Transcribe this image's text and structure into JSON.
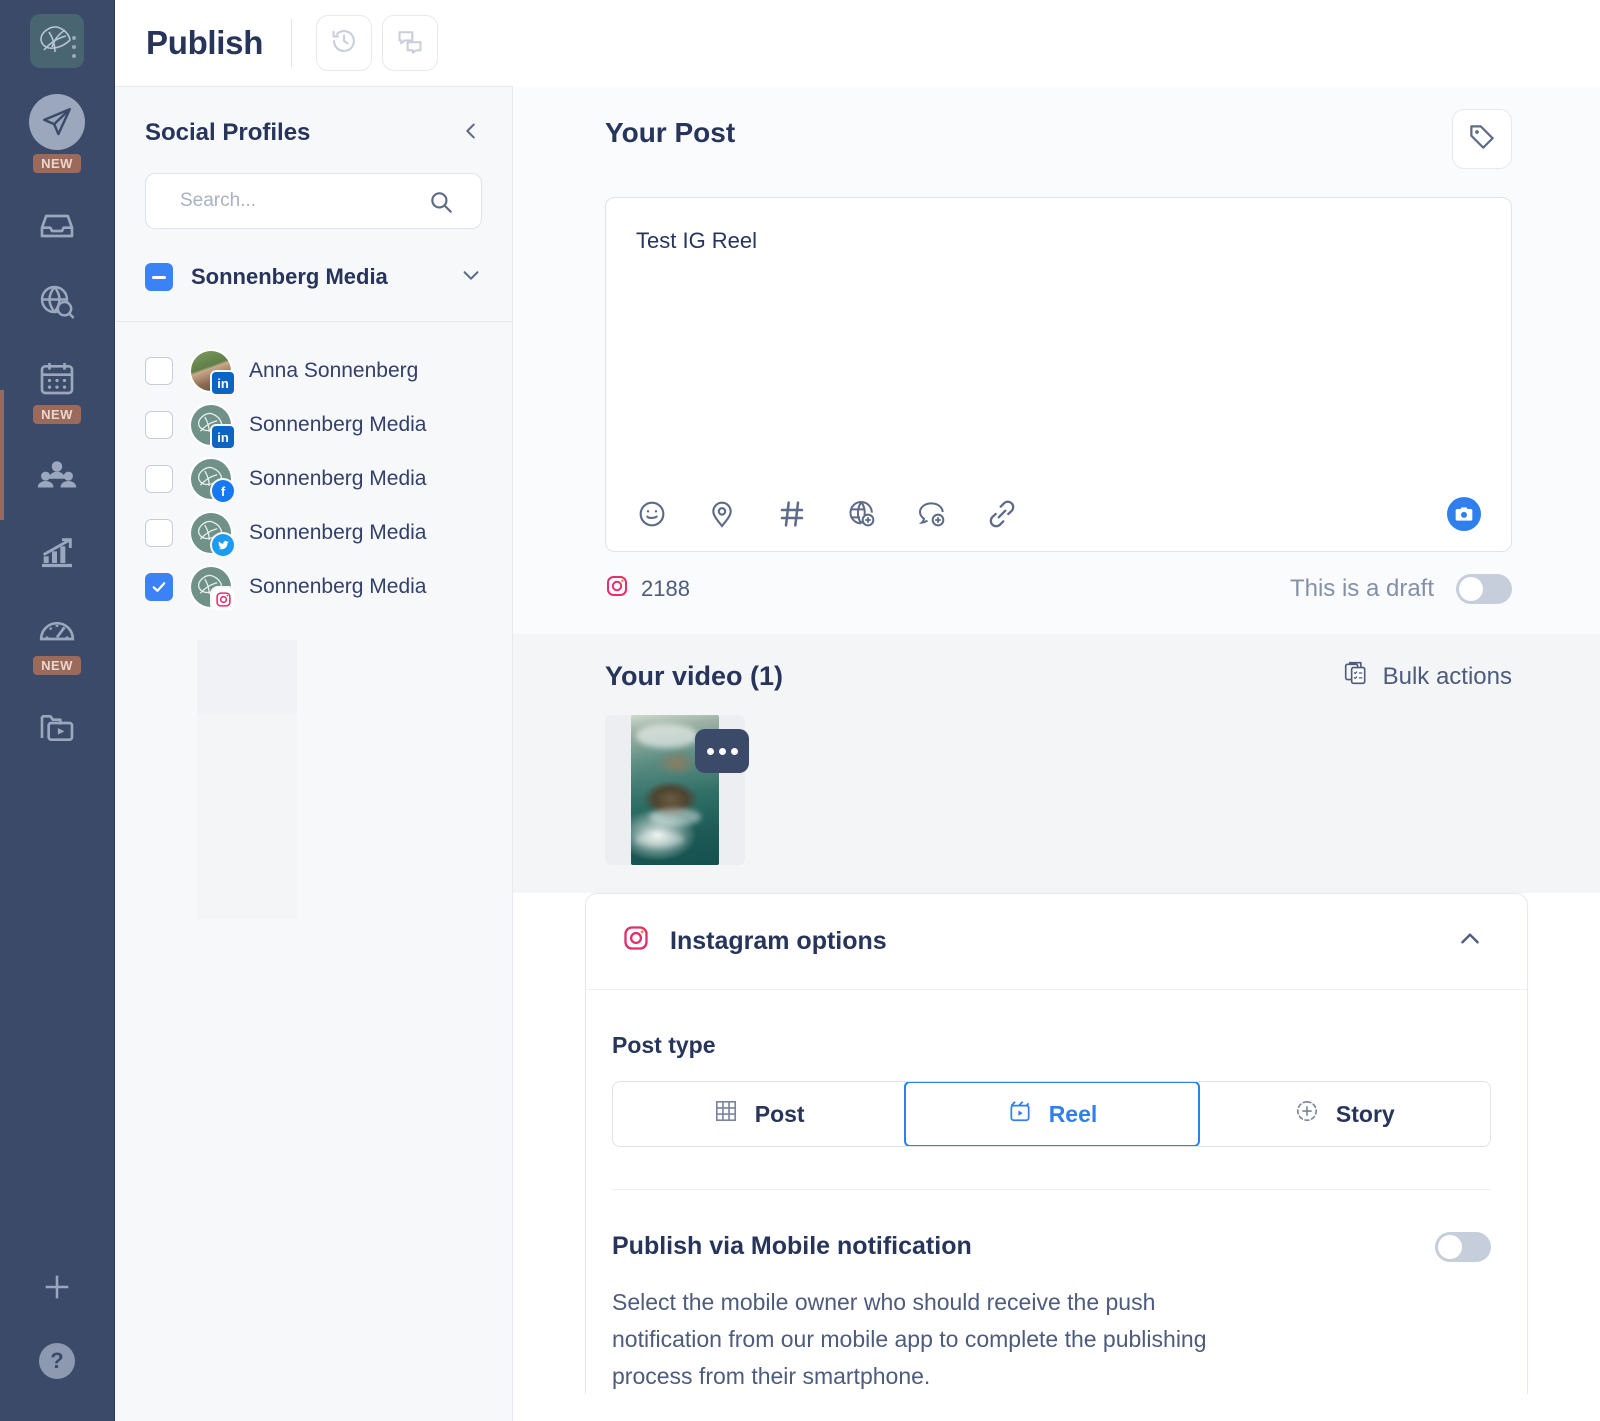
{
  "rail": {
    "logo_icon": "brand-leaf-logo",
    "kebab_icon": "more-vertical-icon",
    "items": [
      {
        "name": "publish",
        "icon": "paper-plane-icon",
        "badge": "NEW",
        "active": true
      },
      {
        "name": "inbox",
        "icon": "inbox-tray-icon",
        "badge": "",
        "active": false
      },
      {
        "name": "listening",
        "icon": "globe-search-icon",
        "badge": "",
        "active": false
      },
      {
        "name": "calendar",
        "icon": "calendar-icon",
        "badge": "NEW",
        "active": false
      },
      {
        "name": "audience",
        "icon": "people-group-icon",
        "badge": "",
        "active": false
      },
      {
        "name": "analytics",
        "icon": "bar-chart-up-icon",
        "badge": "",
        "active": false
      },
      {
        "name": "benchmark",
        "icon": "speedometer-icon",
        "badge": "NEW",
        "active": false
      },
      {
        "name": "library",
        "icon": "media-folder-icon",
        "badge": "",
        "active": false
      }
    ],
    "add_icon": "plus-icon",
    "help_label": "?"
  },
  "header": {
    "title": "Publish",
    "history_icon": "history-clock-icon",
    "comments_icon": "chat-bubbles-icon"
  },
  "profiles_panel": {
    "heading": "Social Profiles",
    "collapse_icon": "chevron-left-icon",
    "search": {
      "placeholder": "Search...",
      "value": "",
      "icon": "search-icon"
    },
    "group": {
      "label": "Sonnenberg Media",
      "checkbox_state": "indeterminate",
      "expand_icon": "chevron-down-icon"
    },
    "items": [
      {
        "label": "Anna Sonnenberg",
        "network": "linkedin",
        "network_glyph": "in",
        "checked": false,
        "avatar": "photo"
      },
      {
        "label": "Sonnenberg Media",
        "network": "linkedin",
        "network_glyph": "in",
        "checked": false,
        "avatar": "logo"
      },
      {
        "label": "Sonnenberg Media",
        "network": "facebook",
        "network_glyph": "f",
        "checked": false,
        "avatar": "logo"
      },
      {
        "label": "Sonnenberg Media",
        "network": "twitter",
        "network_glyph": "t",
        "checked": false,
        "avatar": "logo"
      },
      {
        "label": "Sonnenberg Media",
        "network": "instagram",
        "network_glyph": "ig",
        "checked": true,
        "avatar": "logo"
      }
    ]
  },
  "post": {
    "heading": "Your Post",
    "tag_icon": "tag-icon",
    "text": "Test IG Reel",
    "toolbar": [
      {
        "name": "emoji",
        "icon": "emoji-smiley-icon"
      },
      {
        "name": "location",
        "icon": "location-pin-icon"
      },
      {
        "name": "hashtag",
        "icon": "hashtag-icon"
      },
      {
        "name": "globe",
        "icon": "globe-add-icon"
      },
      {
        "name": "reply",
        "icon": "comment-add-icon"
      },
      {
        "name": "link",
        "icon": "link-chain-icon"
      }
    ],
    "media_button_icon": "camera-icon",
    "counter": {
      "network_icon": "instagram-icon",
      "value": "2188"
    },
    "draft": {
      "label": "This is a draft",
      "enabled": false
    }
  },
  "video": {
    "heading": "Your video (1)",
    "bulk_actions": {
      "label": "Bulk actions",
      "icon": "bulk-actions-icon"
    },
    "thumb_menu_icon": "more-horizontal-icon"
  },
  "instagram_options": {
    "title": "Instagram options",
    "brand_icon": "instagram-icon",
    "collapse_icon": "chevron-up-icon",
    "post_type": {
      "label": "Post type",
      "options": [
        {
          "label": "Post",
          "icon": "grid-icon",
          "selected": false
        },
        {
          "label": "Reel",
          "icon": "reel-play-icon",
          "selected": true
        },
        {
          "label": "Story",
          "icon": "story-plus-icon",
          "selected": false
        }
      ]
    },
    "mobile_notification": {
      "title": "Publish via Mobile notification",
      "description": "Select the mobile owner who should receive the push notification from our mobile app to complete the publishing process from their smartphone.",
      "enabled": false
    }
  },
  "colors": {
    "rail_bg": "#3a4a68",
    "accent_blue": "#2f80ed",
    "checkbox_blue": "#3b82f6",
    "text_dark": "#27355b",
    "text_muted": "#4d5b7c",
    "badge_new": "#9c6a5a"
  }
}
